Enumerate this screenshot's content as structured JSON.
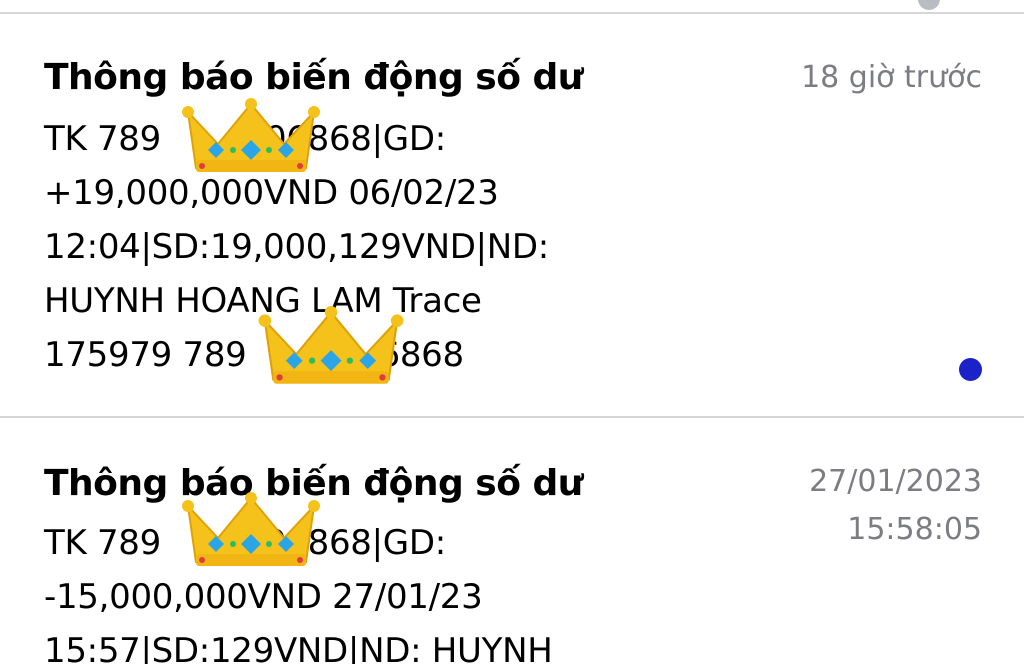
{
  "notifications": [
    {
      "title": "Thông báo biến động số dư",
      "time_lines": [
        "18 giờ trước"
      ],
      "body_lines": [
        "TK 789",
        "06868|GD:",
        "+19,000,000VND 06/02/23",
        "12:04|SD:19,000,129VND|ND:",
        "HUYNH HOANG LAM Trace",
        "175979 789",
        "6868"
      ],
      "unread": true
    },
    {
      "title": "Thông báo biến động số dư",
      "time_lines": [
        "27/01/2023",
        "15:58:05"
      ],
      "body_lines": [
        "TK 789",
        "06868|GD:",
        "-15,000,000VND 27/01/23",
        "15:57|SD:129VND|ND: HUYNH"
      ],
      "unread": false
    }
  ],
  "colors": {
    "unread_dot": "#1a22c8",
    "timestamp": "#7b7d82",
    "divider": "#d6d6d8",
    "crown_gold": "#f5c21b"
  },
  "icons": {
    "redaction": "crown-emoji-icon",
    "unread": "unread-dot-icon"
  }
}
